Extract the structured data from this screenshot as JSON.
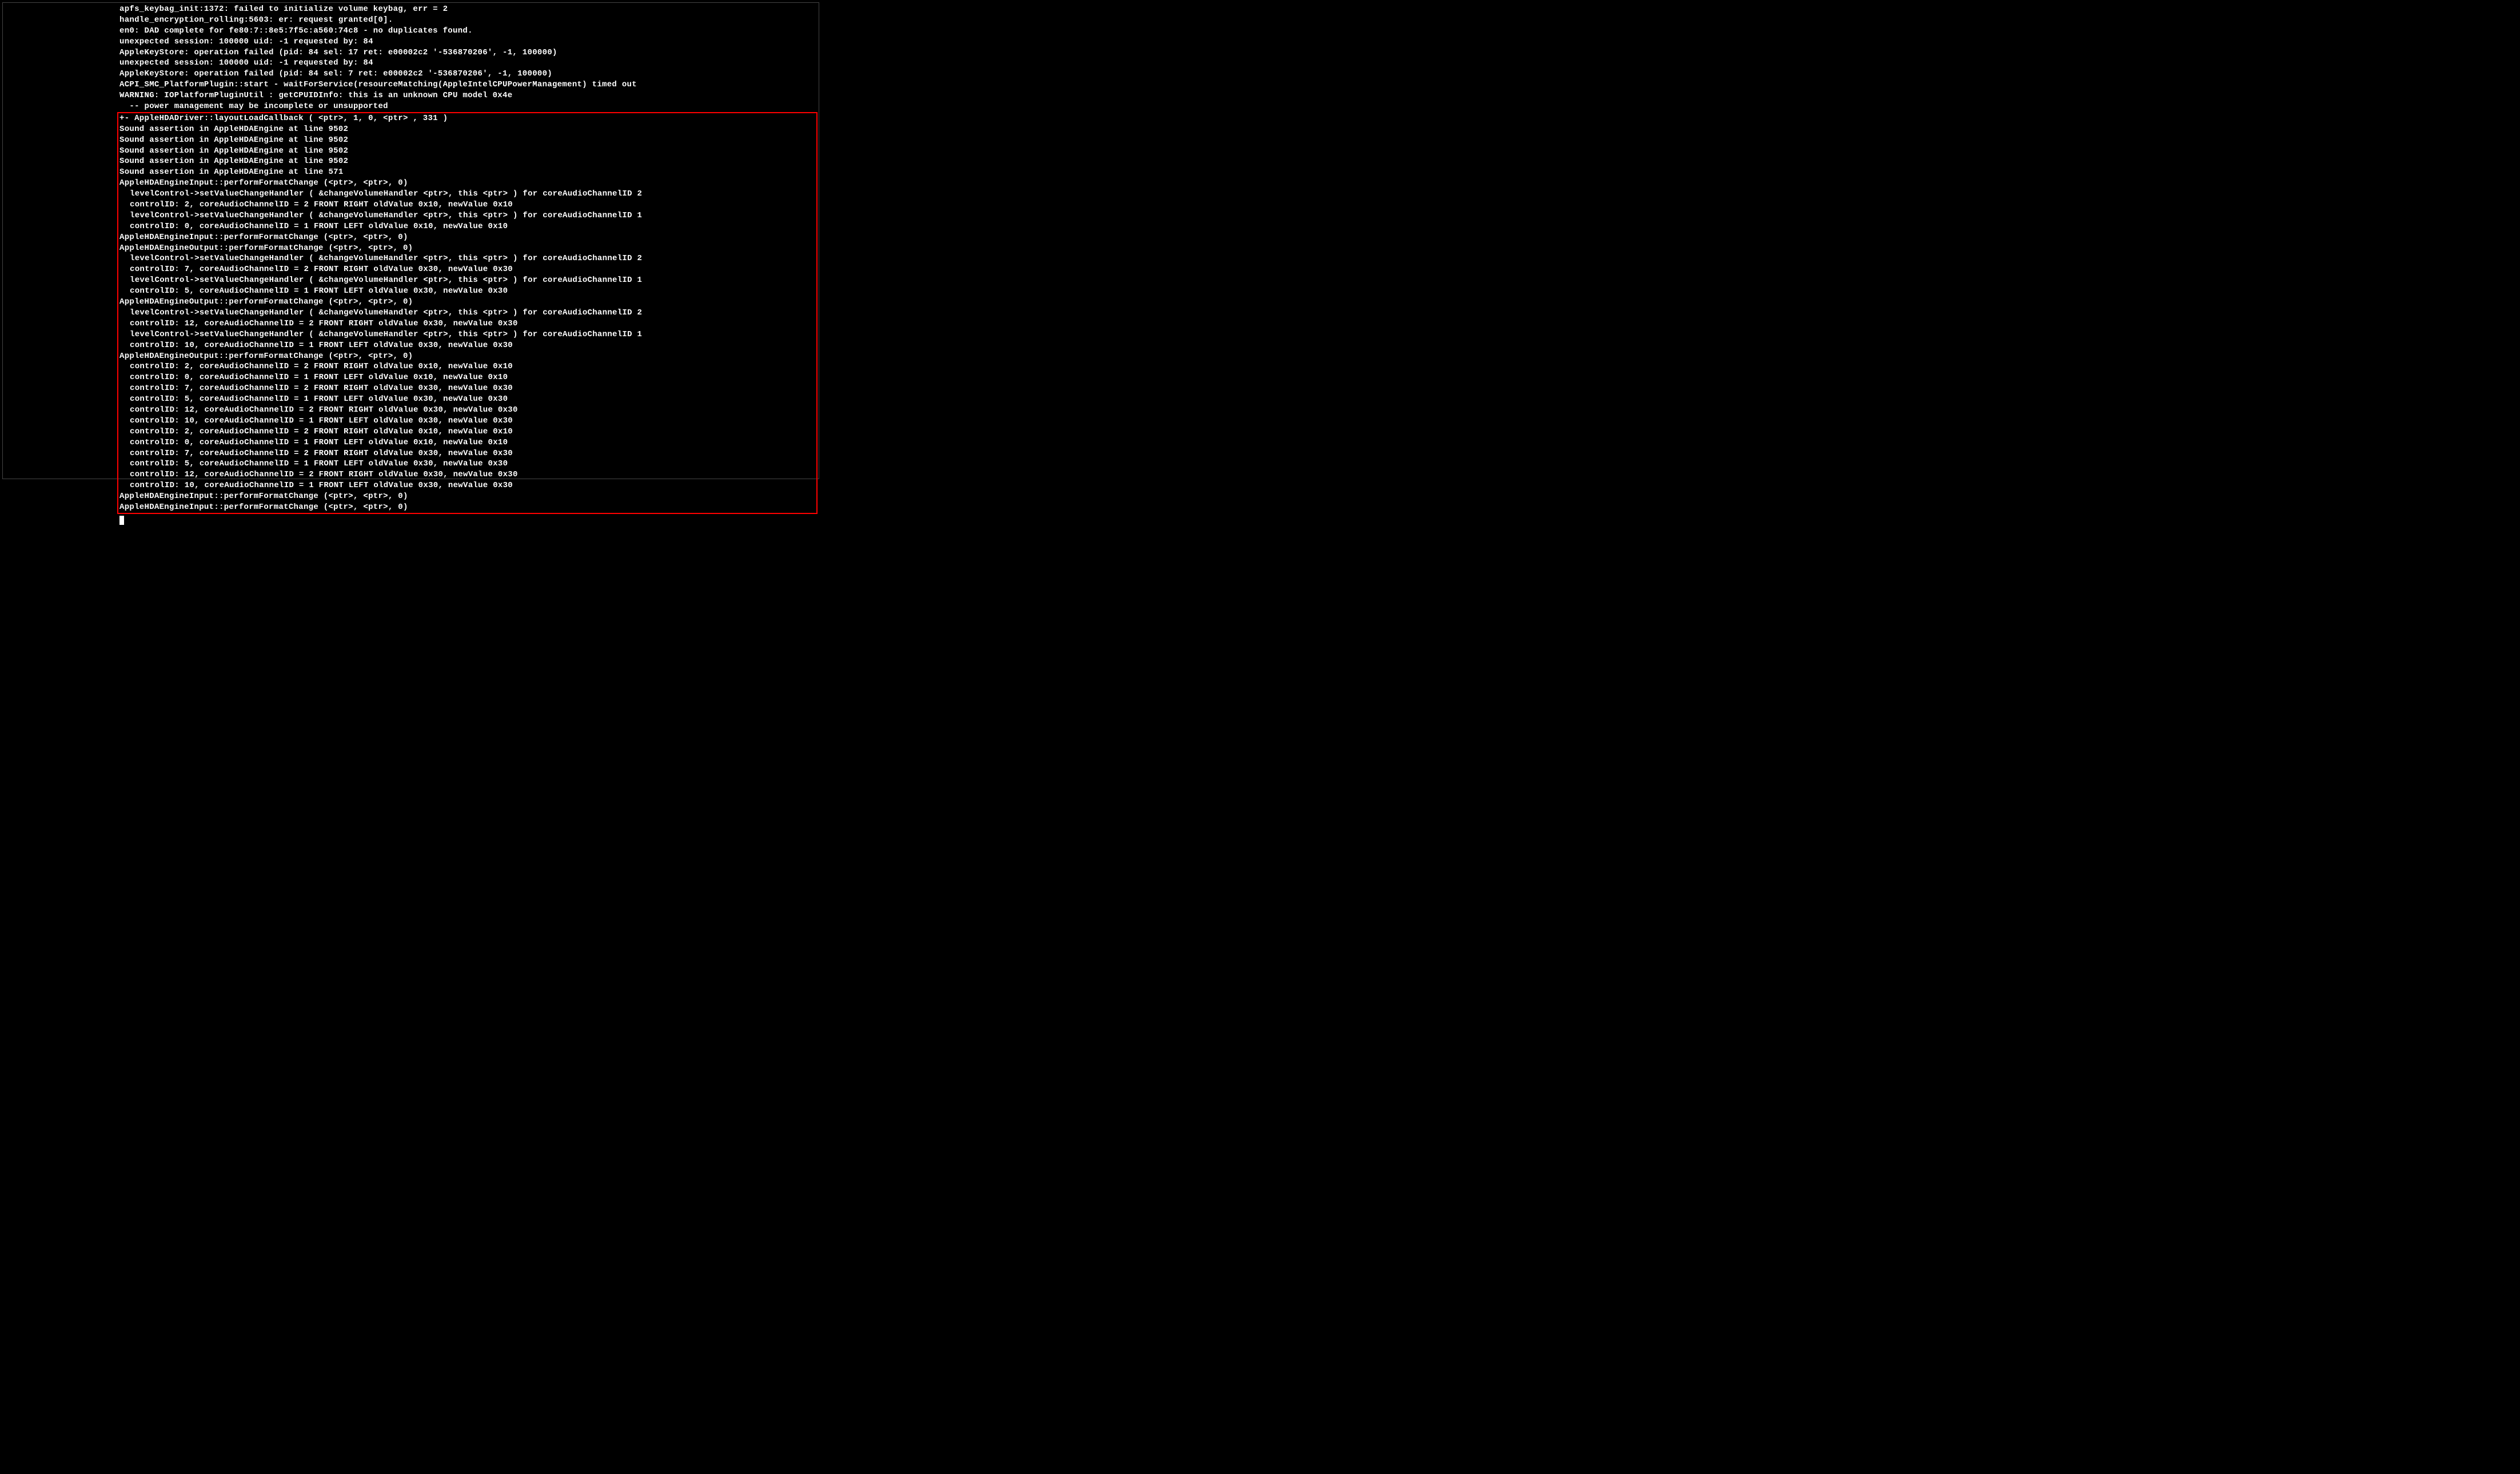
{
  "top_lines": [
    "apfs_keybag_init:1372: failed to initialize volume keybag, err = 2",
    "handle_encryption_rolling:5603: er: request granted[0].",
    "en0: DAD complete for fe80:7::8e5:7f5c:a560:74c8 - no duplicates found.",
    "unexpected session: 100000 uid: -1 requested by: 84",
    "AppleKeyStore: operation failed (pid: 84 sel: 17 ret: e00002c2 '-536870206', -1, 100000)",
    "unexpected session: 100000 uid: -1 requested by: 84",
    "AppleKeyStore: operation failed (pid: 84 sel: 7 ret: e00002c2 '-536870206', -1, 100000)",
    "ACPI_SMC_PlatformPlugin::start - waitForService(resourceMatching(AppleIntelCPUPowerManagement) timed out",
    "WARNING: IOPlatformPluginUtil : getCPUIDInfo: this is an unknown CPU model 0x4e",
    "  -- power management may be incomplete or unsupported"
  ],
  "boxed_lines": [
    {
      "t": "+- AppleHDADriver::layoutLoadCallback ( <ptr>, 1, 0, <ptr> , 331 )",
      "i": 0
    },
    {
      "t": "Sound assertion in AppleHDAEngine at line 9502",
      "i": 0
    },
    {
      "t": "Sound assertion in AppleHDAEngine at line 9502",
      "i": 0
    },
    {
      "t": "Sound assertion in AppleHDAEngine at line 9502",
      "i": 0
    },
    {
      "t": "Sound assertion in AppleHDAEngine at line 9502",
      "i": 0
    },
    {
      "t": "Sound assertion in AppleHDAEngine at line 571",
      "i": 0
    },
    {
      "t": "AppleHDAEngineInput::performFormatChange (<ptr>, <ptr>, 0)",
      "i": 0
    },
    {
      "t": "levelControl->setValueChangeHandler ( &changeVolumeHandler <ptr>, this <ptr> ) for coreAudioChannelID 2",
      "i": 1
    },
    {
      "t": "controlID: 2, coreAudioChannelID = 2 FRONT RIGHT oldValue 0x10, newValue 0x10",
      "i": 1
    },
    {
      "t": "levelControl->setValueChangeHandler ( &changeVolumeHandler <ptr>, this <ptr> ) for coreAudioChannelID 1",
      "i": 1
    },
    {
      "t": "controlID: 0, coreAudioChannelID = 1 FRONT LEFT oldValue 0x10, newValue 0x10",
      "i": 1
    },
    {
      "t": "AppleHDAEngineInput::performFormatChange (<ptr>, <ptr>, 0)",
      "i": 0
    },
    {
      "t": "AppleHDAEngineOutput::performFormatChange (<ptr>, <ptr>, 0)",
      "i": 0
    },
    {
      "t": "levelControl->setValueChangeHandler ( &changeVolumeHandler <ptr>, this <ptr> ) for coreAudioChannelID 2",
      "i": 1
    },
    {
      "t": "controlID: 7, coreAudioChannelID = 2 FRONT RIGHT oldValue 0x30, newValue 0x30",
      "i": 1
    },
    {
      "t": "levelControl->setValueChangeHandler ( &changeVolumeHandler <ptr>, this <ptr> ) for coreAudioChannelID 1",
      "i": 1
    },
    {
      "t": "controlID: 5, coreAudioChannelID = 1 FRONT LEFT oldValue 0x30, newValue 0x30",
      "i": 1
    },
    {
      "t": "AppleHDAEngineOutput::performFormatChange (<ptr>, <ptr>, 0)",
      "i": 0
    },
    {
      "t": "levelControl->setValueChangeHandler ( &changeVolumeHandler <ptr>, this <ptr> ) for coreAudioChannelID 2",
      "i": 1
    },
    {
      "t": "controlID: 12, coreAudioChannelID = 2 FRONT RIGHT oldValue 0x30, newValue 0x30",
      "i": 1
    },
    {
      "t": "levelControl->setValueChangeHandler ( &changeVolumeHandler <ptr>, this <ptr> ) for coreAudioChannelID 1",
      "i": 1
    },
    {
      "t": "controlID: 10, coreAudioChannelID = 1 FRONT LEFT oldValue 0x30, newValue 0x30",
      "i": 1
    },
    {
      "t": "AppleHDAEngineOutput::performFormatChange (<ptr>, <ptr>, 0)",
      "i": 0
    },
    {
      "t": "controlID: 2, coreAudioChannelID = 2 FRONT RIGHT oldValue 0x10, newValue 0x10",
      "i": 1
    },
    {
      "t": "controlID: 0, coreAudioChannelID = 1 FRONT LEFT oldValue 0x10, newValue 0x10",
      "i": 1
    },
    {
      "t": "controlID: 7, coreAudioChannelID = 2 FRONT RIGHT oldValue 0x30, newValue 0x30",
      "i": 1
    },
    {
      "t": "controlID: 5, coreAudioChannelID = 1 FRONT LEFT oldValue 0x30, newValue 0x30",
      "i": 1
    },
    {
      "t": "controlID: 12, coreAudioChannelID = 2 FRONT RIGHT oldValue 0x30, newValue 0x30",
      "i": 1
    },
    {
      "t": "controlID: 10, coreAudioChannelID = 1 FRONT LEFT oldValue 0x30, newValue 0x30",
      "i": 1
    },
    {
      "t": "controlID: 2, coreAudioChannelID = 2 FRONT RIGHT oldValue 0x10, newValue 0x10",
      "i": 1
    },
    {
      "t": "controlID: 0, coreAudioChannelID = 1 FRONT LEFT oldValue 0x10, newValue 0x10",
      "i": 1
    },
    {
      "t": "controlID: 7, coreAudioChannelID = 2 FRONT RIGHT oldValue 0x30, newValue 0x30",
      "i": 1
    },
    {
      "t": "controlID: 5, coreAudioChannelID = 1 FRONT LEFT oldValue 0x30, newValue 0x30",
      "i": 1
    },
    {
      "t": "controlID: 12, coreAudioChannelID = 2 FRONT RIGHT oldValue 0x30, newValue 0x30",
      "i": 1
    },
    {
      "t": "controlID: 10, coreAudioChannelID = 1 FRONT LEFT oldValue 0x30, newValue 0x30",
      "i": 1
    },
    {
      "t": "AppleHDAEngineInput::performFormatChange (<ptr>, <ptr>, 0)",
      "i": 0
    },
    {
      "t": "AppleHDAEngineInput::performFormatChange (<ptr>, <ptr>, 0)",
      "i": 0
    }
  ]
}
